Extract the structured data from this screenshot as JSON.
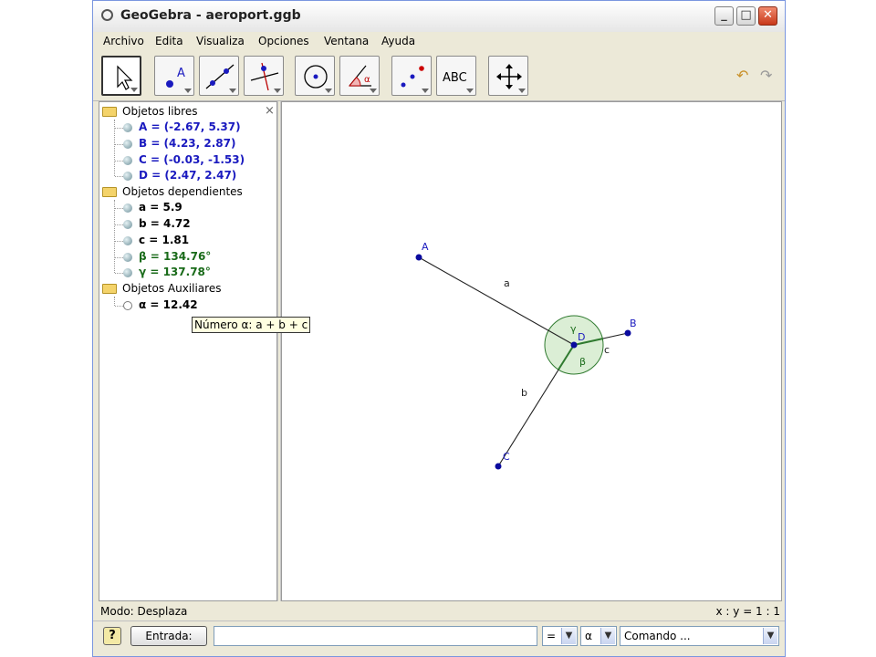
{
  "window": {
    "title": "GeoGebra - aeroport.ggb",
    "minimize": "_",
    "maximize": "□",
    "close": "✕"
  },
  "menu": [
    "Archivo",
    "Edita",
    "Visualiza",
    "Opciones",
    "Ventana",
    "Ayuda"
  ],
  "toolbar": {
    "tools": [
      "pointer-tool",
      "point-tool",
      "line-tool",
      "perpendicular-tool",
      "circle-tool",
      "angle-tool",
      "slider-tool",
      "text-tool",
      "move-view-tool"
    ],
    "point_label": "A",
    "text_label": "ABC",
    "angle_label": "α"
  },
  "algebra": {
    "close": "×",
    "groups": [
      {
        "label": "Objetos libres",
        "items": [
          "A = (-2.67, 5.37)",
          "B = (4.23, 2.87)",
          "C = (-0.03, -1.53)",
          "D = (2.47, 2.47)"
        ]
      },
      {
        "label": "Objetos dependientes",
        "items": [
          "a = 5.9",
          "b = 4.72",
          "c = 1.81",
          "β = 134.76°",
          "γ = 137.78°"
        ]
      },
      {
        "label": "Objetos Auxiliares",
        "items": [
          "α = 12.42"
        ]
      }
    ],
    "tooltip": "Número α: a + b + c"
  },
  "graphics": {
    "points": [
      "A",
      "B",
      "C",
      "D"
    ],
    "segments": [
      "a",
      "b",
      "c"
    ],
    "angles": [
      "γ",
      "β"
    ],
    "point_color": "#0a0a9e",
    "angle_fill": "#cfe8c7",
    "angle_stroke": "#2f7a2f"
  },
  "status": {
    "mode": "Modo: Desplaza",
    "ratio": "x : y = 1 : 1"
  },
  "input": {
    "help": "?",
    "entrada": "Entrada:",
    "value": "",
    "eq_select": "=",
    "alpha_select": "α",
    "command_select": "Comando ..."
  }
}
